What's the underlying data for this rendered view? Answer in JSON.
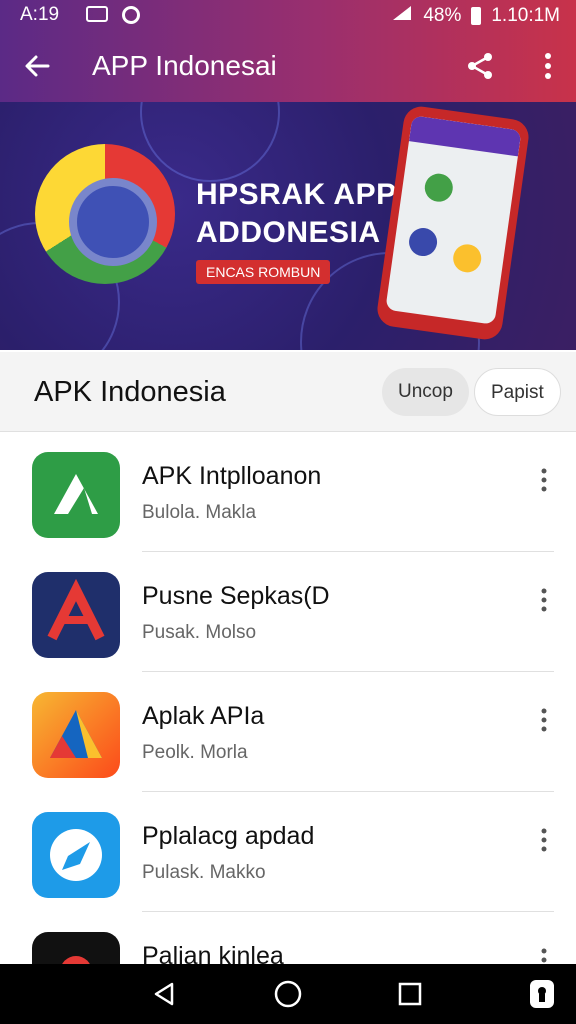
{
  "status_bar": {
    "time": "A:19",
    "battery": "48%",
    "clock": "1.10:1M"
  },
  "app_bar": {
    "title": "APP Indonesai",
    "back_icon": "arrow-left-icon",
    "share_icon": "share-icon",
    "more_icon": "more-vert-icon"
  },
  "banner": {
    "headline_line1": "HPSRAK APP",
    "headline_line2": "ADDONESIA",
    "tag": "ENCAS ROMBUN"
  },
  "section": {
    "heading": "APK Indonesia",
    "chip_a": "Uncop",
    "chip_b": "Papist"
  },
  "apps": [
    {
      "name": "APK Intplloanon",
      "sub": "Bulola. Makla",
      "icon_color": "#2e9d46"
    },
    {
      "name": "Pusne Sepkas(D",
      "sub": "Pusak. Molso",
      "icon_color": "#1f2f6b"
    },
    {
      "name": "Aplak APIa",
      "sub": "Peolk. Morla",
      "icon_color": "#f1a21a"
    },
    {
      "name": "Pplalacg apdad",
      "sub": "Pulask. Makko",
      "icon_color": "#1e9be8"
    },
    {
      "name": "Palian kinlea",
      "sub": "",
      "icon_color": "#111111"
    }
  ],
  "nav": {
    "back": "nav-back-icon",
    "home": "nav-home-icon",
    "recents": "nav-recents-icon",
    "extra": "lock-icon"
  }
}
